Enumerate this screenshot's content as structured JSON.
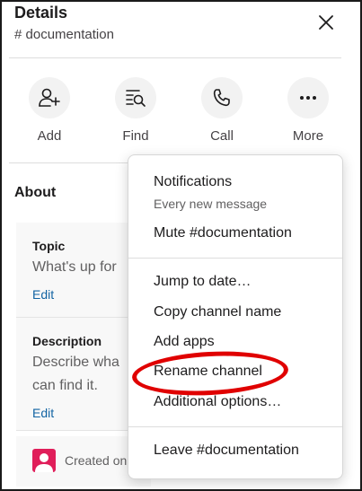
{
  "header": {
    "title": "Details",
    "channel": "# documentation"
  },
  "actions": [
    {
      "label": "Add",
      "icon": "add-person-icon"
    },
    {
      "label": "Find",
      "icon": "search-list-icon"
    },
    {
      "label": "Call",
      "icon": "phone-icon"
    },
    {
      "label": "More",
      "icon": "more-icon"
    }
  ],
  "about": {
    "title": "About",
    "topic": {
      "label": "Topic",
      "text": "What's up for",
      "edit": "Edit"
    },
    "description": {
      "label": "Description",
      "line1": "Describe wha",
      "line2": "can find it.",
      "edit": "Edit"
    },
    "created": "Created on"
  },
  "menu": {
    "notifications": "Notifications",
    "notifications_sub": "Every new message",
    "mute": "Mute #documentation",
    "jump": "Jump to date…",
    "copy": "Copy channel name",
    "add_apps": "Add apps",
    "rename": "Rename channel",
    "additional": "Additional options…",
    "leave": "Leave #documentation"
  },
  "colors": {
    "link": "#1264a3",
    "annotation": "#e00000",
    "avatar": "#e01e5a"
  }
}
